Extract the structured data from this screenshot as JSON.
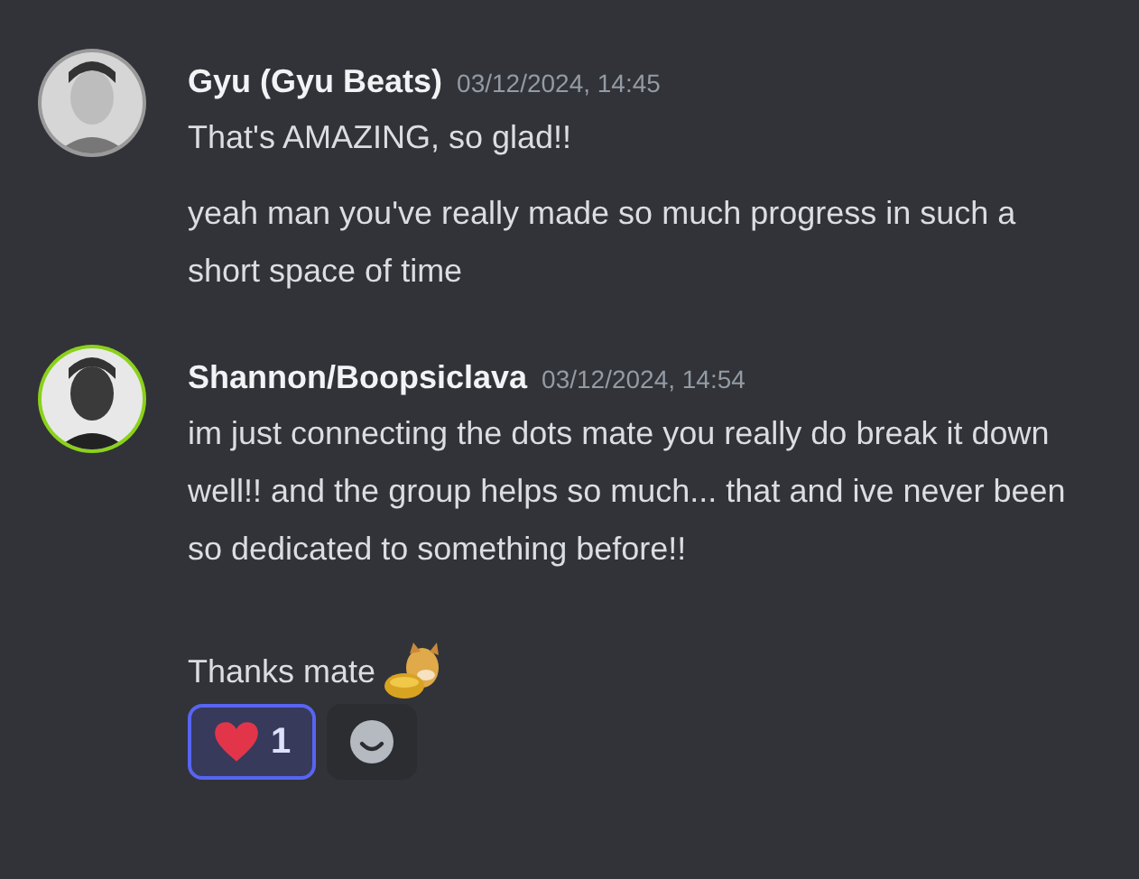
{
  "messages": [
    {
      "author": "Gyu (Gyu Beats)",
      "timestamp": "03/12/2024, 14:45",
      "avatar": {
        "ring": false
      },
      "blocks": [
        {
          "text": "That's AMAZING, so glad!!",
          "sticker": false
        },
        {
          "text": "yeah man you've really made so much progress in such a short space of time",
          "sticker": false
        }
      ]
    },
    {
      "author": "Shannon/Boopsiclava",
      "timestamp": "03/12/2024, 14:54",
      "avatar": {
        "ring": true
      },
      "blocks": [
        {
          "text": "im just connecting the dots mate you really do break it down well!! and the group helps so much... that and ive never been so dedicated to something before!!",
          "sticker": false
        },
        {
          "text": "Thanks mate",
          "sticker": true
        }
      ],
      "reactions": [
        {
          "kind": "heart",
          "count": "1",
          "selected": true
        }
      ]
    }
  ]
}
